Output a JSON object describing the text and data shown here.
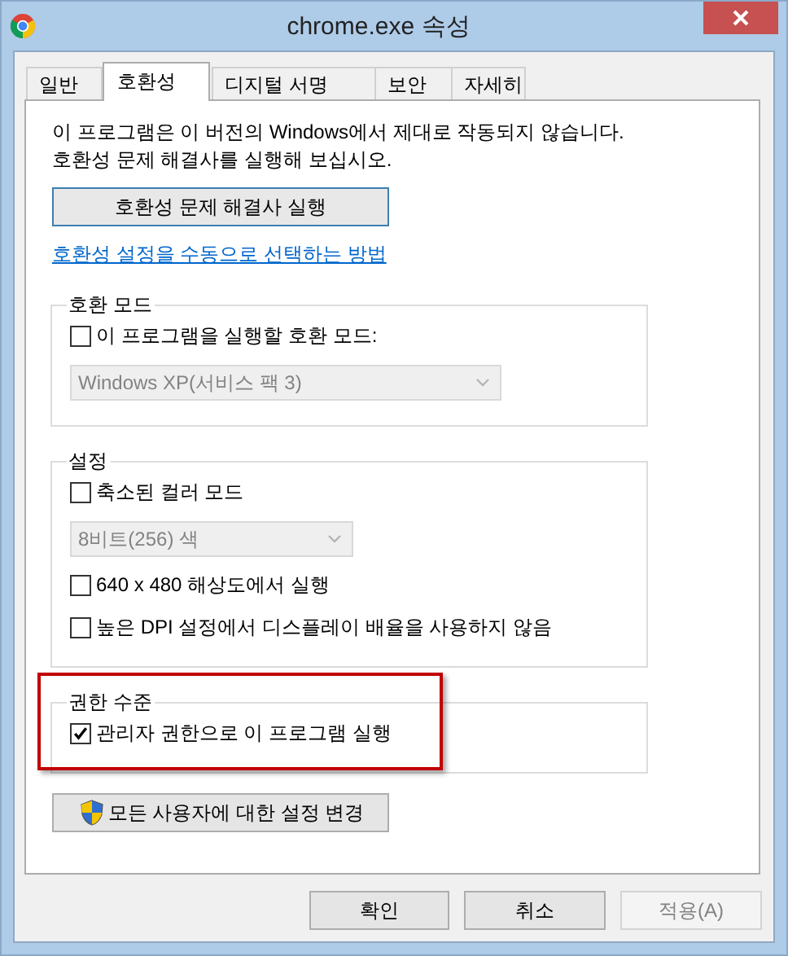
{
  "window": {
    "title": "chrome.exe 속성"
  },
  "tabs": [
    {
      "label": "일반",
      "selected": false
    },
    {
      "label": "호환성",
      "selected": true
    },
    {
      "label": "디지털 서명",
      "selected": false
    },
    {
      "label": "보안",
      "selected": false
    },
    {
      "label": "자세히",
      "selected": false
    }
  ],
  "message": [
    "이 프로그램은 이 버전의 Windows에서 제대로 작동되지 않습니다.",
    "호환성 문제 해결사를 실행해 보십시오."
  ],
  "troubleshooter_button": "호환성 문제 해결사 실행",
  "manual_link": "호환성 설정을 수동으로 선택하는 방법",
  "groups": [
    {
      "title": "호환 모드",
      "highlighted": false,
      "items": [
        {
          "kind": "checkbox",
          "label": "이 프로그램을 실행할 호환 모드:",
          "checked": false
        },
        {
          "kind": "dropdown",
          "value": "Windows XP(서비스 팩 3)",
          "disabled": true,
          "wide": true
        }
      ]
    },
    {
      "title": "설정",
      "highlighted": false,
      "items": [
        {
          "kind": "checkbox",
          "label": "축소된 컬러 모드",
          "checked": false
        },
        {
          "kind": "dropdown",
          "value": "8비트(256) 색",
          "disabled": true,
          "wide": false
        },
        {
          "kind": "checkbox",
          "label": "640 x 480 해상도에서 실행",
          "checked": false
        },
        {
          "kind": "checkbox",
          "label": "높은 DPI 설정에서 디스플레이 배율을 사용하지 않음",
          "checked": false
        }
      ]
    },
    {
      "title": "권한 수준",
      "highlighted": true,
      "items": [
        {
          "kind": "checkbox",
          "label": "관리자 권한으로 이 프로그램 실행",
          "checked": true
        }
      ]
    }
  ],
  "all_users_button": "모든 사용자에 대한 설정 변경",
  "buttons": [
    {
      "label": "확인",
      "disabled": false
    },
    {
      "label": "취소",
      "disabled": false
    },
    {
      "label": "적용(A)",
      "disabled": true
    }
  ]
}
